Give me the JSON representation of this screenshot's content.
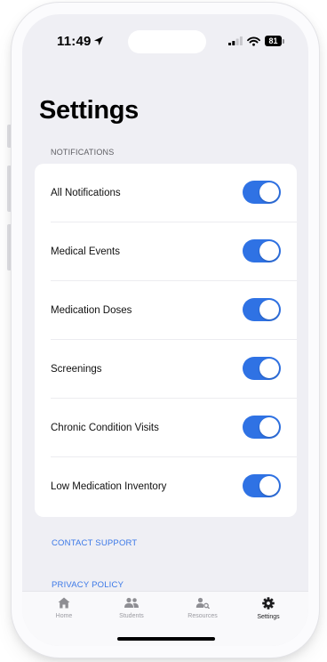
{
  "status_bar": {
    "time": "11:49",
    "battery_level": "81"
  },
  "page": {
    "title": "Settings"
  },
  "notifications": {
    "section_title": "NOTIFICATIONS",
    "items": [
      {
        "label": "All Notifications",
        "enabled": true
      },
      {
        "label": "Medical Events",
        "enabled": true
      },
      {
        "label": "Medication Doses",
        "enabled": true
      },
      {
        "label": "Screenings",
        "enabled": true
      },
      {
        "label": "Chronic Condition Visits",
        "enabled": true
      },
      {
        "label": "Low Medication Inventory",
        "enabled": true
      }
    ]
  },
  "links": {
    "contact_support": "CONTACT SUPPORT",
    "privacy_policy": "PRIVACY POLICY"
  },
  "tab_bar": {
    "active": "Settings",
    "tabs": [
      {
        "label": "Home",
        "icon": "home-icon"
      },
      {
        "label": "Students",
        "icon": "students-icon"
      },
      {
        "label": "Resources",
        "icon": "resources-icon"
      },
      {
        "label": "Settings",
        "icon": "gear-icon"
      }
    ]
  },
  "colors": {
    "accent": "#2f72e4",
    "link": "#3b78e7",
    "background": "#efeff4"
  }
}
